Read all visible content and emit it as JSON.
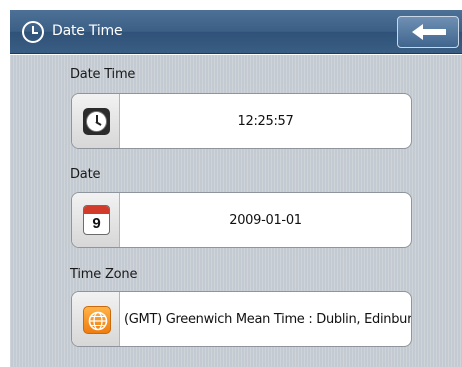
{
  "header": {
    "title": "Date Time",
    "back_icon": "arrow-left-icon"
  },
  "sections": {
    "datetime": {
      "label": "Date Time",
      "value": "12:25:57",
      "icon": "clock-icon"
    },
    "date": {
      "label": "Date",
      "value": "2009-01-01",
      "icon": "calendar-icon",
      "calendar_day": "9"
    },
    "timezone": {
      "label": "Time Zone",
      "value": "(GMT) Greenwich Mean Time : Dublin, Edinburgh...",
      "icon": "globe-icon"
    }
  },
  "colors": {
    "titlebar": "#3a5d83",
    "background": "#c4cad1",
    "accent_orange": "#f07c10"
  }
}
